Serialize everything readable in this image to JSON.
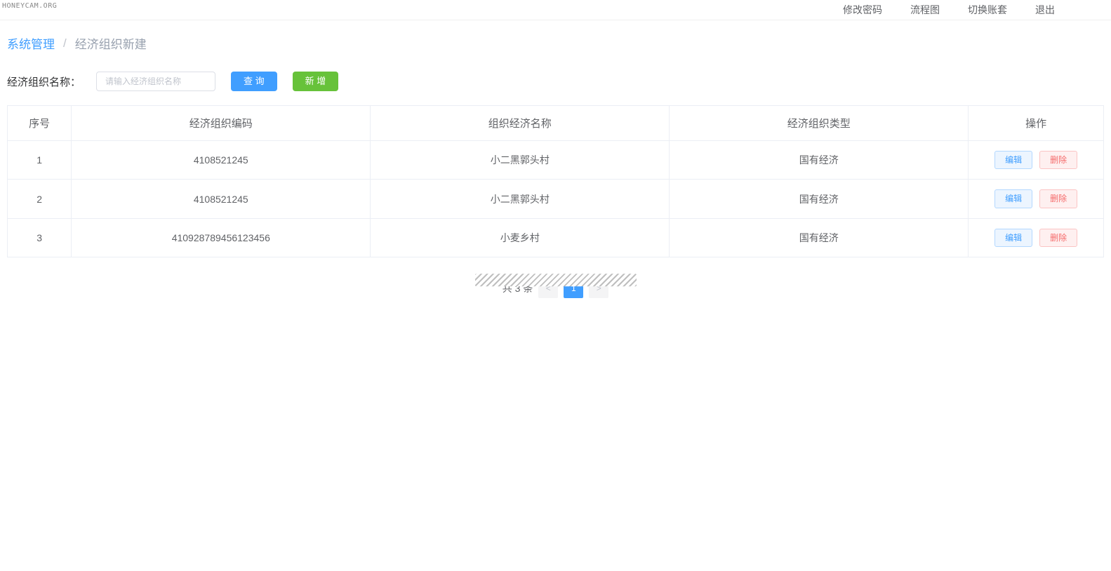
{
  "watermark": "HONEYCAM.ORG",
  "topNav": {
    "changePassword": "修改密码",
    "flowchart": "流程图",
    "switchAccount": "切换账套",
    "exit": "退出"
  },
  "breadcrumb": {
    "root": "系统管理",
    "separator": "/",
    "current": "经济组织新建"
  },
  "filter": {
    "label": "经济组织名称：",
    "placeholder": "请输入经济组织名称",
    "queryBtn": "查 询",
    "addBtn": "新 增"
  },
  "table": {
    "headers": {
      "seq": "序号",
      "code": "经济组织编码",
      "name": "组织经济名称",
      "type": "经济组织类型",
      "action": "操作"
    },
    "actionLabels": {
      "edit": "编辑",
      "delete": "删除"
    },
    "rows": [
      {
        "seq": "1",
        "code": "4108521245",
        "name": "小二黑郭头村",
        "type": "国有经济"
      },
      {
        "seq": "2",
        "code": "4108521245",
        "name": "小二黑郭头村",
        "type": "国有经济"
      },
      {
        "seq": "3",
        "code": "410928789456123456",
        "name": "小麦乡村",
        "type": "国有经济"
      }
    ]
  },
  "pagination": {
    "total": "共 3 条",
    "prev": "<",
    "page1": "1",
    "next": ">"
  }
}
